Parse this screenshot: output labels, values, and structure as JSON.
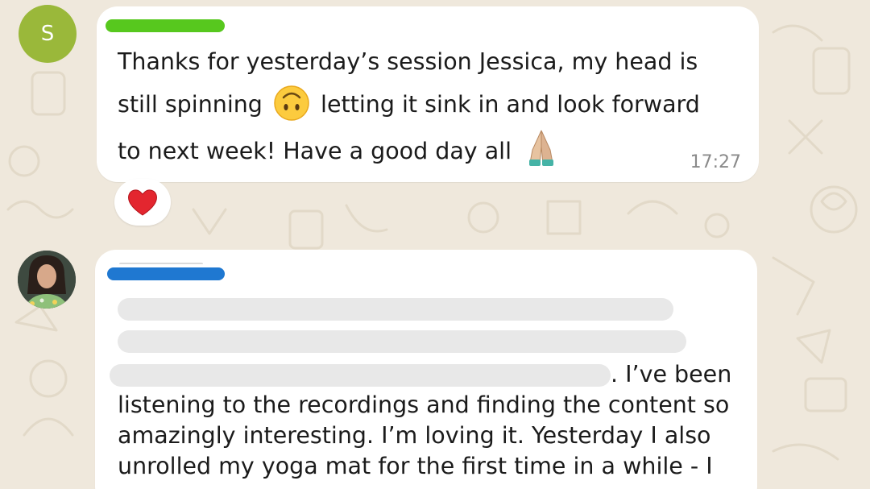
{
  "messages": [
    {
      "avatar_initial": "S",
      "lines": [
        "Thanks for yesterday’s session Jessica, my head is",
        "still spinning",
        "letting it sink in and look forward",
        "to next week! Have a good day all"
      ],
      "time": "17:27",
      "reaction": "heart"
    },
    {
      "lines_visible_tail": ". I’ve been",
      "lines": [
        "listening to the recordings and finding the content so",
        "amazingly interesting. I’m loving it. Yesterday I also",
        "unrolled my yoga mat for the first time in a while - I"
      ]
    }
  ],
  "colors": {
    "wallpaper": "#efe8dc",
    "avatar_s": "#9ab83a",
    "name_redact_green": "#57c81e",
    "name_redact_blue": "#1f78d1",
    "bubble": "#ffffff",
    "timestamp": "#8a8a8a"
  },
  "icons": [
    "upside-down-face-emoji",
    "folded-hands-emoji",
    "red-heart-emoji"
  ]
}
